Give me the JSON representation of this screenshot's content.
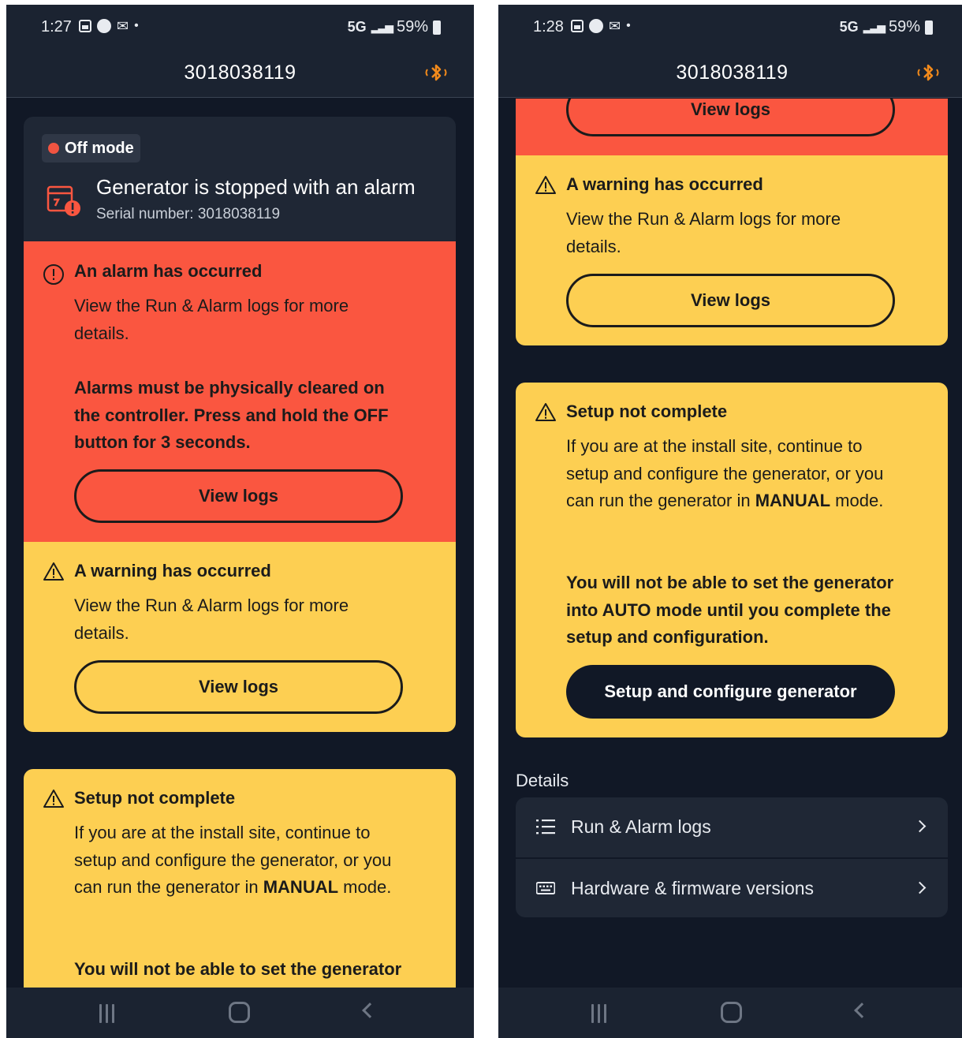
{
  "screen1": {
    "status": {
      "time": "1:27",
      "network": "5G",
      "battery": "59%"
    },
    "header": {
      "title": "3018038119"
    },
    "mode_badge": "Off mode",
    "generator": {
      "title": "Generator is stopped with an alarm",
      "serial": "Serial number: 3018038119"
    },
    "alarm": {
      "title": "An alarm has occurred",
      "body": "View the Run & Alarm logs for more details.",
      "bold": "Alarms must be physically cleared on the controller. Press and hold the OFF button for 3 seconds.",
      "button": "View logs"
    },
    "warning": {
      "title": "A warning has occurred",
      "body": "View the Run & Alarm logs for more details.",
      "button": "View logs"
    },
    "setup": {
      "title": "Setup not complete",
      "body_pre": "If you are at the install site, continue to setup and configure the generator, or you can run the generator in ",
      "body_bold": "MANUAL",
      "body_post": " mode.",
      "bold": "You will not be able to set the generator"
    }
  },
  "screen2": {
    "status": {
      "time": "1:28",
      "network": "5G",
      "battery": "59%"
    },
    "header": {
      "title": "3018038119"
    },
    "alarm_button": "View logs",
    "warning": {
      "title": "A warning has occurred",
      "body": "View the Run & Alarm logs for more details.",
      "button": "View logs"
    },
    "setup": {
      "title": "Setup not complete",
      "body_pre": "If you are at the install site, continue to setup and configure the generator, or you can run the generator in ",
      "body_bold": "MANUAL",
      "body_post": " mode.",
      "bold": "You will not be able to set the generator into AUTO mode until you complete the setup and configuration.",
      "button": "Setup and configure generator"
    },
    "details": {
      "label": "Details",
      "items": [
        {
          "label": "Run & Alarm logs",
          "icon": "list-icon"
        },
        {
          "label": "Hardware & firmware versions",
          "icon": "keyboard-icon"
        }
      ]
    }
  },
  "colors": {
    "background": "#111826",
    "alarm": "#fa5640",
    "warning": "#fdcf52",
    "bluetooth": "#f28a1b",
    "off_dot": "#f15441"
  }
}
